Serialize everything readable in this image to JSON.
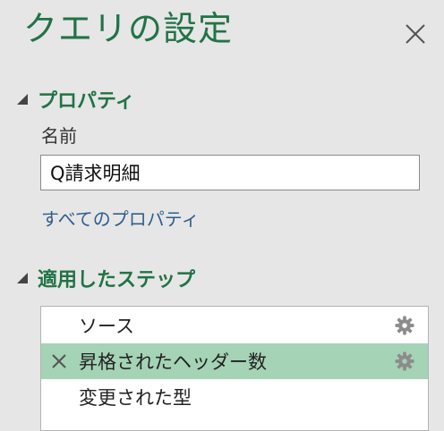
{
  "pane": {
    "title": "クエリの設定",
    "close_icon": "close-icon"
  },
  "properties": {
    "section_title": "プロパティ",
    "name_label": "名前",
    "name_value": "Q請求明細",
    "all_properties_link": "すべてのプロパティ"
  },
  "applied_steps": {
    "section_title": "適用したステップ",
    "items": [
      {
        "label": "ソース",
        "selected": false,
        "has_settings": true
      },
      {
        "label": "昇格されたヘッダー数",
        "selected": true,
        "has_settings": true
      },
      {
        "label": "変更された型",
        "selected": false,
        "has_settings": false
      }
    ]
  },
  "colors": {
    "accent": "#217346",
    "link": "#2f5e8e",
    "selected_row": "#a4d3b5",
    "background": "#e6e6e6"
  }
}
